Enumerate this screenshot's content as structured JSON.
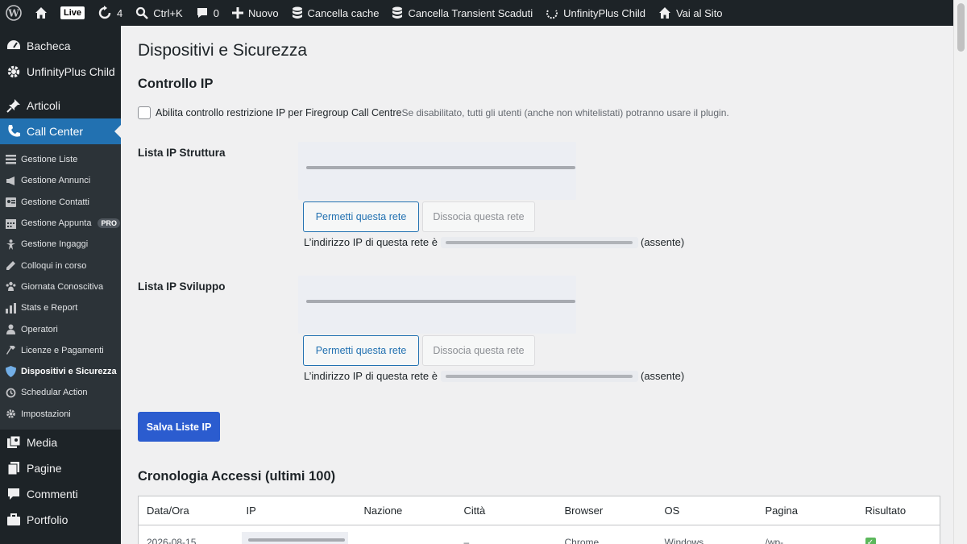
{
  "adminbar": {
    "live_label": "Live",
    "updates_count": "4",
    "search_shortcut": "Ctrl+K",
    "comments_count": "0",
    "new_label": "Nuovo",
    "clear_cache_label": "Cancella cache",
    "clear_transient_label": "Cancella Transient Scaduti",
    "site_name": "UnfinityPlus Child",
    "visit_site_label": "Vai al Sito"
  },
  "sidebar": {
    "top_items": [
      {
        "label": "Bacheca",
        "icon": "dashboard-icon"
      },
      {
        "label": "UnfinityPlus Child",
        "icon": "gear-icon"
      },
      {
        "label": "Articoli",
        "icon": "pin-icon"
      },
      {
        "label": "Call Center",
        "icon": "phone-icon"
      }
    ],
    "submenu": [
      {
        "label": "Gestione Liste",
        "icon": "list-icon"
      },
      {
        "label": "Gestione Annunci",
        "icon": "megaphone-icon"
      },
      {
        "label": "Gestione Contatti",
        "icon": "contacts-icon"
      },
      {
        "label": "Gestione Appunta",
        "icon": "calendar-icon",
        "badge": "PRO"
      },
      {
        "label": "Gestione Ingaggi",
        "icon": "star-person-icon"
      },
      {
        "label": "Colloqui in corso",
        "icon": "pencil-icon"
      },
      {
        "label": "Giornata Conoscitiva",
        "icon": "group-icon"
      },
      {
        "label": "Stats e Report",
        "icon": "chart-icon"
      },
      {
        "label": "Operatori",
        "icon": "user-icon"
      },
      {
        "label": "Licenze e Pagamenti",
        "icon": "hammer-icon"
      },
      {
        "label": "Dispositivi e Sicurezza",
        "icon": "shield-icon"
      },
      {
        "label": "Schedular Action",
        "icon": "history-icon"
      },
      {
        "label": "Impostazioni",
        "icon": "gear-icon"
      }
    ],
    "bottom_items": [
      {
        "label": "Media",
        "icon": "media-icon"
      },
      {
        "label": "Pagine",
        "icon": "page-icon"
      },
      {
        "label": "Commenti",
        "icon": "comment-icon"
      },
      {
        "label": "Portfolio",
        "icon": "portfolio-icon"
      }
    ]
  },
  "main": {
    "page_title": "Dispositivi e Sicurezza",
    "ip_control_title": "Controllo IP",
    "checkbox_label": "Abilita controllo restrizione IP per Firegroup Call Centre",
    "checkbox_desc": "Se disabilitato, tutti gli utenti (anche non whitelistati) potranno usare il plugin.",
    "structure_label": "Lista IP Struttura",
    "dev_label": "Lista IP Sviluppo",
    "allow_network_label": "Permetti questa rete",
    "dissociate_network_label": "Dissocia questa rete",
    "network_ip_prefix": "L’indirizzo IP di questa rete è",
    "network_ip_suffix": "(assente)",
    "save_button": "Salva Liste IP",
    "history_title": "Cronologia Accessi (ultimi 100)",
    "table": {
      "headers": [
        "Data/Ora",
        "IP",
        "Nazione",
        "Città",
        "Browser",
        "OS",
        "Pagina",
        "Risultato"
      ],
      "rows": [
        {
          "date": "2026-08-15",
          "country": "",
          "city": "–",
          "browser": "Chrome",
          "os": "Windows",
          "page": "/wp-",
          "result": "✓"
        }
      ]
    }
  }
}
